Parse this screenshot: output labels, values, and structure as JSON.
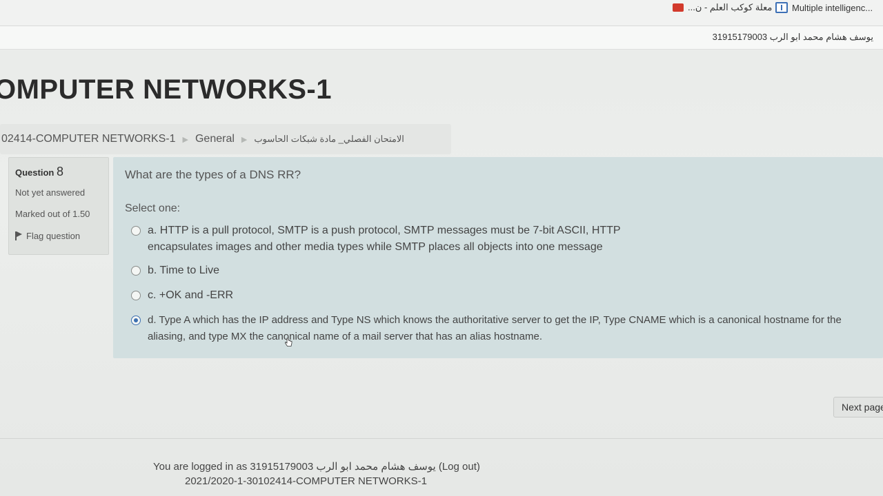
{
  "bookmarks": {
    "item1": "معلة كوكب العلم - ن...",
    "item2": "Multiple intelligenc..."
  },
  "header": {
    "username": "يوسف هشام محمد ابو الرب 31915179003"
  },
  "course": {
    "title": "OMPUTER NETWORKS-1"
  },
  "breadcrumb": {
    "course": "02414-COMPUTER NETWORKS-1",
    "section": "General",
    "quiz": "الامتحان الفصلي_ مادة شبكات الحاسوب"
  },
  "question": {
    "label": "Question",
    "number": "8",
    "state": "Not yet answered",
    "grade": "Marked out of 1.50",
    "flag": "Flag question",
    "text": "What are the types of a DNS RR?",
    "prompt": "Select one:",
    "answers": [
      {
        "text": "a. HTTP is a pull protocol, SMTP is a push protocol, SMTP messages must be 7-bit ASCII, HTTP encapsulates images and other media types while SMTP places all objects into one message",
        "checked": false
      },
      {
        "text": "b. Time to Live",
        "checked": false
      },
      {
        "text": "c. +OK and -ERR",
        "checked": false
      },
      {
        "text": "d. Type A which has the IP address and Type NS which knows the authoritative server to get the IP, Type CNAME which is a canonical hostname for the aliasing, and type MX the canonical name of a mail server that has an alias hostname.",
        "checked": true
      }
    ]
  },
  "navigation": {
    "next": "Next page"
  },
  "footer": {
    "logged_in_prefix": "You are logged in as",
    "user": "31915179003 يوسف هشام محمد ابو الرب",
    "logout": "(Log out)",
    "course_code": "2021/2020-1-30102414-COMPUTER NETWORKS-1"
  },
  "colors": {
    "question_bg": "#d2dfe0",
    "info_bg": "#dfe2df",
    "radio_checked": "#3c6fb0"
  }
}
